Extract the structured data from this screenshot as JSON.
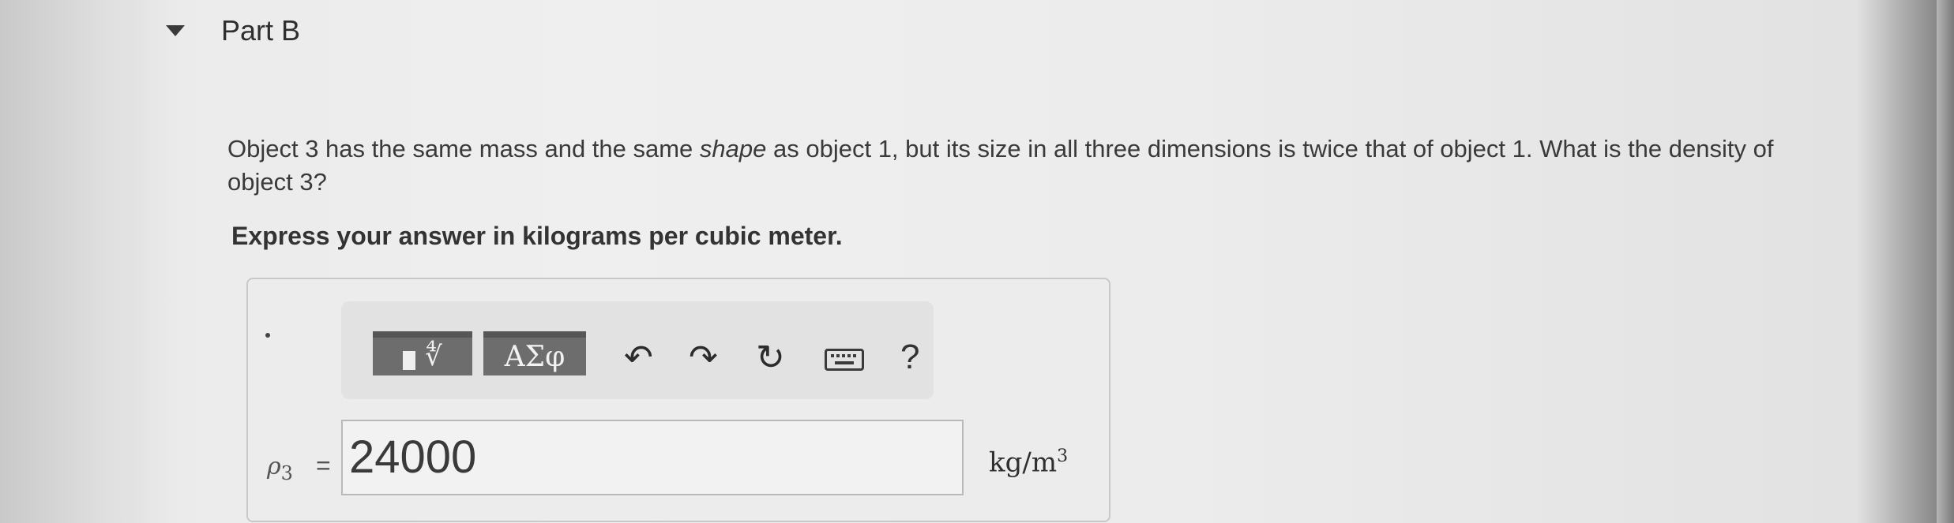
{
  "part": {
    "title": "Part B"
  },
  "question": {
    "text_before_em": "Object 3 has the same mass and the same ",
    "emphasis": "shape",
    "text_after_em": " as object 1, but its size in all three dimensions is twice that of object 1. What is the density of object 3?",
    "instruction": "Express your answer in kilograms per cubic meter."
  },
  "toolbar": {
    "greek_label": "ΑΣφ",
    "templates_glyph": "∜",
    "undo_glyph": "↶",
    "redo_glyph": "↷",
    "reset_glyph": "↻",
    "help_label": "?"
  },
  "answer": {
    "variable_symbol": "ρ",
    "variable_subscript": "3",
    "equals": "=",
    "value": "24000",
    "unit_base": "kg/m",
    "unit_exponent": "3"
  },
  "icons": {
    "collapse": "triangle-down-icon",
    "templates": "templates-icon",
    "greek": "greek-symbols-icon",
    "undo": "undo-icon",
    "redo": "redo-icon",
    "reset": "reset-icon",
    "keyboard": "keyboard-icon",
    "help": "help-icon"
  }
}
